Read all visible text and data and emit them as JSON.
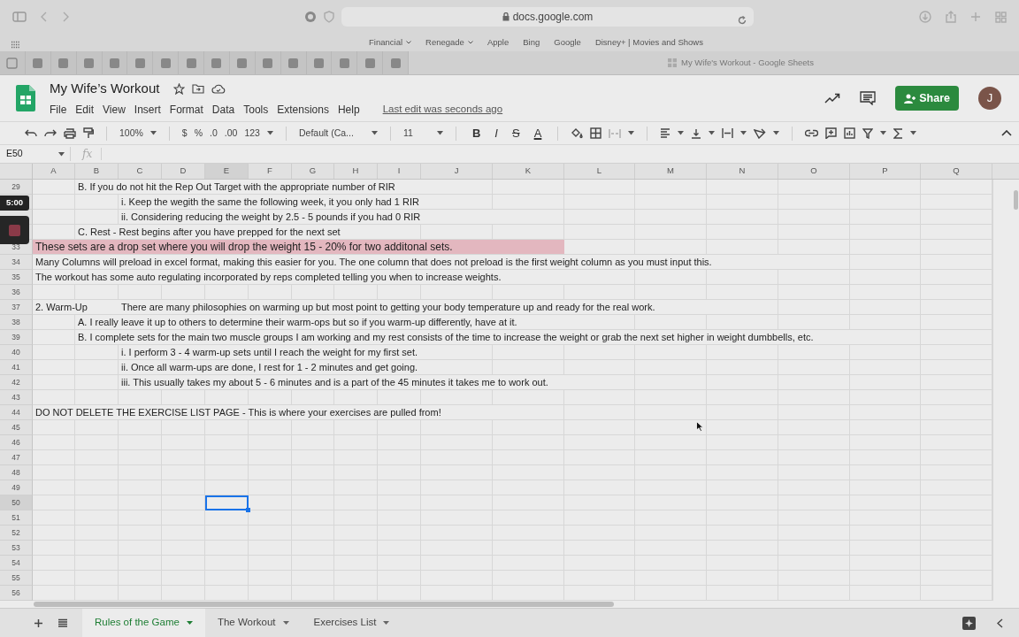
{
  "browser": {
    "address": "docs.google.com",
    "bookmarks": [
      {
        "label": "Financial",
        "menu": true
      },
      {
        "label": "Renegade",
        "menu": true
      },
      {
        "label": "Apple",
        "menu": false
      },
      {
        "label": "Bing",
        "menu": false
      },
      {
        "label": "Google",
        "menu": false
      },
      {
        "label": "Disney+ | Movies and Shows",
        "menu": false
      }
    ],
    "tab_title": "My Wife's Workout - Google Sheets"
  },
  "app": {
    "title": "My Wife’s Workout",
    "menu": [
      "File",
      "Edit",
      "View",
      "Insert",
      "Format",
      "Data",
      "Tools",
      "Extensions",
      "Help"
    ],
    "last_edit": "Last edit was seconds ago",
    "share": "Share",
    "avatar": "J"
  },
  "toolbar": {
    "zoom": "100%",
    "currency": "$",
    "percent": "%",
    "decrease_decimal": ".0",
    "increase_decimal": ".00",
    "number_format": "123",
    "font": "Default (Ca...",
    "font_size": "11",
    "format_glyphs": [
      "B",
      "I",
      "S",
      "A"
    ]
  },
  "formula_bar": {
    "cell": "E50",
    "fx": "fx"
  },
  "columns": [
    {
      "label": "A",
      "selected": false
    },
    {
      "label": "B",
      "selected": false
    },
    {
      "label": "C",
      "selected": false
    },
    {
      "label": "D",
      "selected": false
    },
    {
      "label": "E",
      "selected": true
    },
    {
      "label": "F",
      "selected": false
    },
    {
      "label": "G",
      "selected": false
    },
    {
      "label": "H",
      "selected": false
    },
    {
      "label": "I",
      "selected": false
    },
    {
      "label": "J",
      "selected": false
    },
    {
      "label": "K",
      "selected": false
    },
    {
      "label": "L",
      "selected": false
    },
    {
      "label": "M",
      "selected": false
    },
    {
      "label": "N",
      "selected": false
    },
    {
      "label": "O",
      "selected": false
    },
    {
      "label": "P",
      "selected": false
    },
    {
      "label": "Q",
      "selected": false
    }
  ],
  "rows": [
    {
      "number": "29",
      "selected": false,
      "highlighted": false,
      "cells": [
        {
          "kind": "level_1",
          "text": "B. If you do not hit the Rep Out Target with the appropriate number of RIR"
        }
      ]
    },
    {
      "selected": false,
      "highlighted": false,
      "cells": [
        {
          "kind": "level_2",
          "text": "i. Keep the wegith the same the following week, it you only had 1 RIR"
        }
      ]
    },
    {
      "selected": false,
      "highlighted": false,
      "cells": [
        {
          "kind": "level_2",
          "text": "ii. Considering reducing the weight  by 2.5 - 5 pounds if you had 0 RIR"
        }
      ]
    },
    {
      "selected": false,
      "highlighted": false,
      "cells": [
        {
          "kind": "level_1",
          "text": "C. Rest - Rest begins after you have prepped for the next set"
        }
      ]
    },
    {
      "number": "33",
      "selected": false,
      "highlighted": true,
      "cells": [
        {
          "kind": "level_0",
          "text": "These sets are a drop set where you will drop the weight 15 - 20% for two additonal sets."
        }
      ]
    },
    {
      "number": "34",
      "selected": false,
      "highlighted": false,
      "cells": [
        {
          "kind": "level_0",
          "text": "Many Columns will preload in excel format, making this easier for you. The one column that does not preload is the first weight column as you must input this."
        }
      ]
    },
    {
      "number": "35",
      "selected": false,
      "highlighted": false,
      "cells": [
        {
          "kind": "level_0",
          "text": "The workout has some auto regulating incorporated by reps completed telling you when to increase weights."
        }
      ]
    },
    {
      "number": "36",
      "selected": false,
      "highlighted": false,
      "cells": []
    },
    {
      "number": "37",
      "selected": false,
      "highlighted": false,
      "cells": [
        {
          "kind": "level_0",
          "text": "2. Warm-Up"
        },
        {
          "kind": "level_2",
          "text": "There are many philosophies on warming up but most point to getting your body temperature up and ready for the real work."
        }
      ]
    },
    {
      "number": "38",
      "selected": false,
      "highlighted": false,
      "cells": [
        {
          "kind": "level_1",
          "text": "A. I really leave it up to others to determine their warm-ops but so if you warm-up differently, have at it."
        }
      ]
    },
    {
      "number": "39",
      "selected": false,
      "highlighted": false,
      "cells": [
        {
          "kind": "level_1",
          "text": "B. I complete sets for the main two muscle groups I am working and my rest consists of the time to increase the weight or grab the next set higher in weight dumbbells, etc."
        }
      ]
    },
    {
      "number": "40",
      "selected": false,
      "highlighted": false,
      "cells": [
        {
          "kind": "level_2",
          "text": "i. I perform 3 - 4 warm-up sets until I reach the weight for my first set."
        }
      ]
    },
    {
      "number": "41",
      "selected": false,
      "highlighted": false,
      "cells": [
        {
          "kind": "level_2",
          "text": "ii. Once all warm-ups are done, I rest for 1 - 2 minutes and get going."
        }
      ]
    },
    {
      "number": "42",
      "selected": false,
      "highlighted": false,
      "cells": [
        {
          "kind": "level_2",
          "text": "iii. This usually takes my about 5 - 6 minutes and is a part of the 45 minutes it takes me to work out."
        }
      ]
    },
    {
      "number": "43",
      "selected": false,
      "highlighted": false,
      "cells": []
    },
    {
      "number": "44",
      "selected": false,
      "highlighted": false,
      "cells": [
        {
          "kind": "level_0",
          "text": "DO NOT DELETE THE EXERCISE LIST PAGE - This is where your exercises are pulled from!"
        }
      ]
    },
    {
      "number": "45",
      "selected": false,
      "highlighted": false,
      "cells": []
    },
    {
      "number": "46",
      "selected": false,
      "highlighted": false,
      "cells": []
    },
    {
      "number": "47",
      "selected": false,
      "highlighted": false,
      "cells": []
    },
    {
      "number": "48",
      "selected": false,
      "highlighted": false,
      "cells": []
    },
    {
      "number": "49",
      "selected": false,
      "highlighted": false,
      "cells": []
    },
    {
      "number": "50",
      "selected": true,
      "highlighted": false,
      "cells": []
    },
    {
      "number": "51",
      "selected": false,
      "highlighted": false,
      "cells": []
    },
    {
      "number": "52",
      "selected": false,
      "highlighted": false,
      "cells": []
    },
    {
      "number": "53",
      "selected": false,
      "highlighted": false,
      "cells": []
    },
    {
      "number": "54",
      "selected": false,
      "highlighted": false,
      "cells": []
    },
    {
      "number": "55",
      "selected": false,
      "highlighted": false,
      "cells": []
    },
    {
      "number": "56",
      "selected": false,
      "highlighted": false,
      "cells": []
    }
  ],
  "recorder": {
    "timer": "5:00"
  },
  "sheet_tabs": [
    {
      "label": "Rules of the Game",
      "selected": true
    },
    {
      "label": "The Workout",
      "selected": false
    },
    {
      "label": "Exercises List",
      "selected": false
    }
  ]
}
